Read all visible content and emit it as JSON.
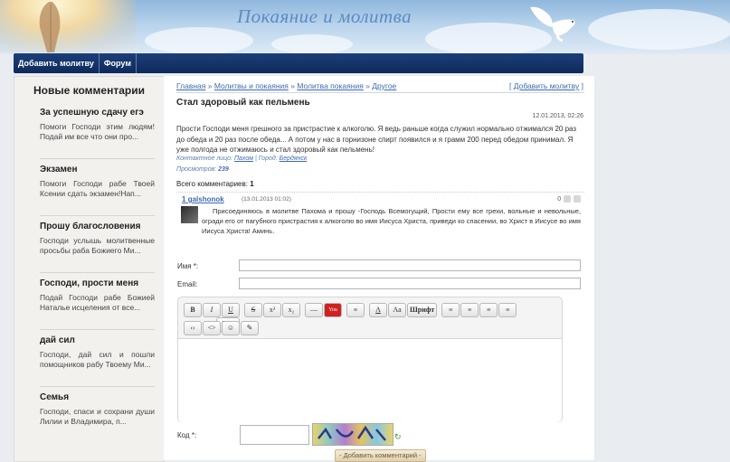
{
  "header": {
    "site_title": "Покаяние и молитва"
  },
  "nav": {
    "items": [
      "Добавить молитву",
      "Форум"
    ]
  },
  "sidebar": {
    "heading": "Новые комментарии",
    "items": [
      {
        "title": "За успешную сдачу егэ",
        "text": "Помоги Господи этим людям!Подай им все что они про..."
      },
      {
        "title": "Экзамен",
        "text": "Помоги Господи рабе Твоей Ксении сдать экзамен!Нап..."
      },
      {
        "title": "Прошу благословения",
        "text": "Господи услышь молитвенные просьбы раба Божиего Ми..."
      },
      {
        "title": "Господи, прости меня",
        "text": "Подай Господи рабе Божией Наталье исцеления от все..."
      },
      {
        "title": "дай сил",
        "text": "Господи, дай сил и пошли помощников рабу Твоему Ми..."
      },
      {
        "title": "Семья",
        "text": "Господи, спаси и сохрани души Лилии и Владимира, п..."
      }
    ]
  },
  "breadcrumbs": {
    "items": [
      "Главная",
      "Молитвы и покаяния",
      "Молитва покаяния",
      "Другое"
    ],
    "separator": "»"
  },
  "add_prayer_link": {
    "open": "[ ",
    "label": "Добавить молитву",
    "close": " ]"
  },
  "post": {
    "title": "Стал здоровый как пельмень",
    "date": "12.01.2013, 02:26",
    "text": "Прости Господи меня грешного за пристрастие к алкоголю. Я ведь раньше когда служил нормально отжимался 20 раз до обеда и 20 раз после обеда... А потом у нас в горнизоне спирт появился и я грамм 200 перед обедом принимал. Я уже полгода не отжимаюсь и стал здоровый как пельмень!",
    "contact_label": "Контактное лицо:",
    "contact_name": "Пахом",
    "city_label": "Город:",
    "city": "Бердянск",
    "views_label": "Просмотров:",
    "views": "239"
  },
  "comments": {
    "total_label": "Всего комментариев:",
    "total": "1",
    "items": [
      {
        "number": "1",
        "author": "galshonok",
        "date": "(13.01.2013 01:02)",
        "rating": "0",
        "text": "Присоединяюсь в молитве Пахома и прошу -Господь Всемогущий, Прости ему все грехи, вольные и невольные, огради его от пагубного пристрастия к алкоголю во имя Иисуса Христа, приведи ко спасении, во Христ в Иисусе во имя Иисуса Христа! Аминь."
      }
    ]
  },
  "form": {
    "name_label": "Имя *:",
    "email_label": "Email:",
    "captcha_label": "Код *:",
    "submit_label": "- Добавить комментарий -",
    "toolbar_row1": [
      "B",
      "I",
      "U",
      "S",
      "x²",
      "x₂",
      "—",
      "You",
      "≡",
      "A",
      "Aa",
      "Шрифт",
      "≡",
      "≡",
      "≡",
      "≡",
      "[bb]"
    ],
    "toolbar_row2": [
      "‹‹",
      "<>",
      "☺",
      "✎"
    ]
  }
}
